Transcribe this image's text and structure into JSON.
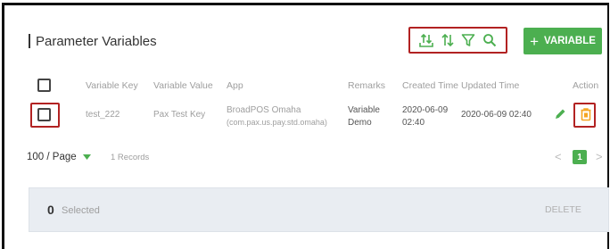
{
  "panel": {
    "title": "Parameter Variables"
  },
  "toolbar": {
    "icons": [
      "upload-download-icon",
      "sort-icon",
      "filter-icon",
      "search-icon"
    ],
    "add_label": "VARIABLE",
    "add_icon": "+",
    "accent_color": "#4caf50",
    "highlight_color": "#b22222"
  },
  "table": {
    "headers": [
      "Variable Key",
      "Variable Value",
      "App",
      "Remarks",
      "Created Time",
      "Updated Time",
      "Action"
    ],
    "rows": [
      {
        "key": "test_222",
        "value": "Pax Test Key",
        "app_name": "BroadPOS Omaha",
        "app_package": "(com.pax.us.pay.std.omaha)",
        "remarks_line1": "Variable",
        "remarks_line2": "Demo",
        "created_date": "2020-06-09",
        "created_time": "02:40",
        "updated": "2020-06-09 02:40"
      }
    ]
  },
  "pager": {
    "page_size": "100 / Page",
    "records": "1 Records",
    "current_page": "1",
    "prev": "<",
    "next": ">"
  },
  "footer": {
    "selected_count": "0",
    "selected_label": "Selected",
    "delete_label": "DELETE"
  }
}
